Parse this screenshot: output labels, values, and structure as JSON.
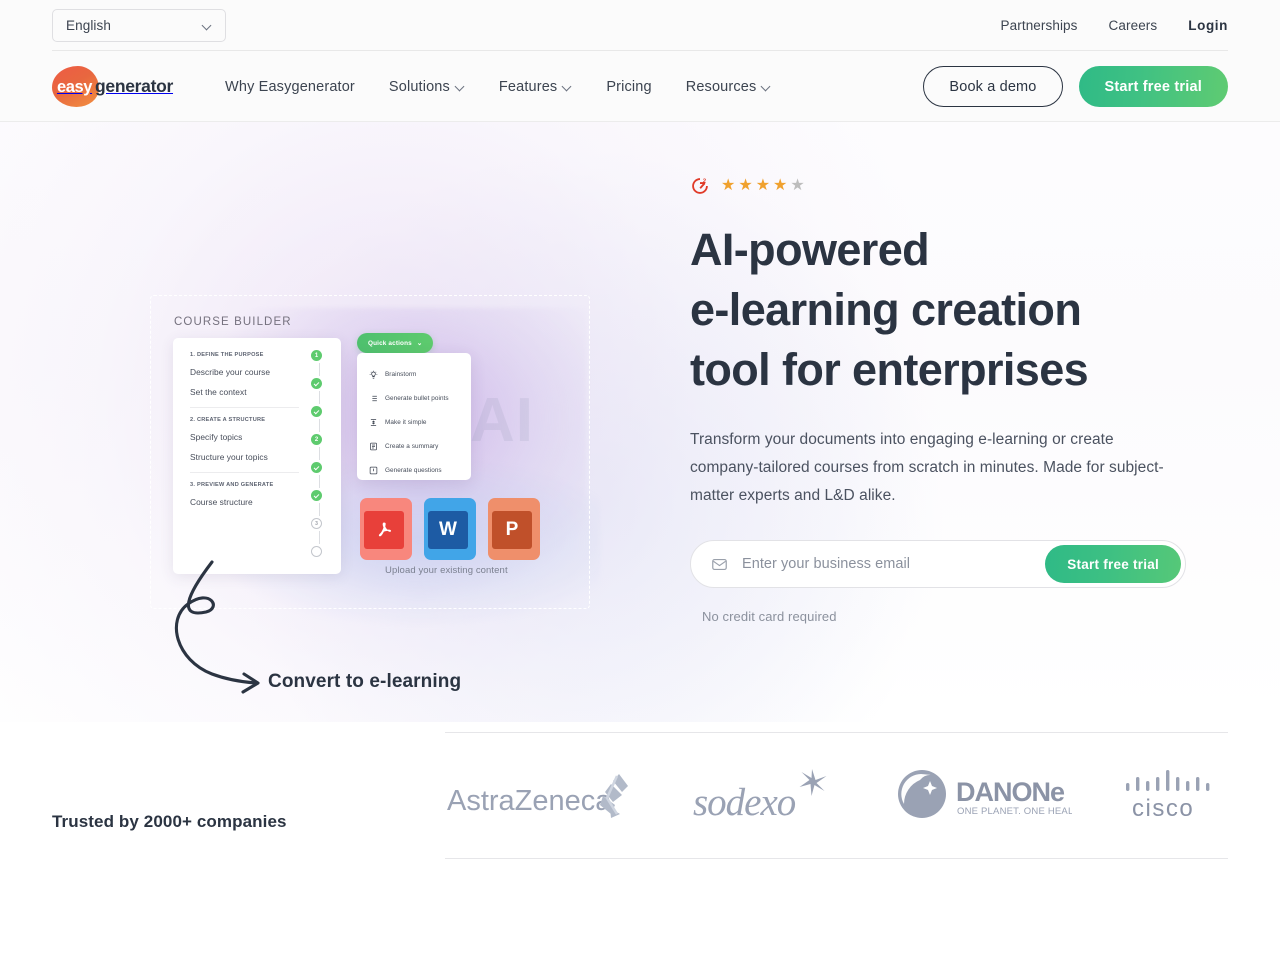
{
  "topbar": {
    "language": "English",
    "language_icon": "chevron-down-icon",
    "links": [
      {
        "label": "Partnerships",
        "bold": false
      },
      {
        "label": "Careers",
        "bold": false
      },
      {
        "label": "Login",
        "bold": true
      }
    ]
  },
  "nav": {
    "logo": {
      "mark_text": "easy",
      "word": "generator"
    },
    "items": [
      {
        "label": "Why Easygenerator",
        "has_dropdown": false
      },
      {
        "label": "Solutions",
        "has_dropdown": true
      },
      {
        "label": "Features",
        "has_dropdown": true
      },
      {
        "label": "Pricing",
        "has_dropdown": false
      },
      {
        "label": "Resources",
        "has_dropdown": true
      }
    ],
    "demo_button": "Book a demo",
    "trial_button": "Start free trial"
  },
  "hero": {
    "rating": {
      "badge": "G2",
      "badge_sup": "2",
      "stars": 4.5,
      "star_count": 5,
      "filled": 4
    },
    "headline_lines": [
      "AI-powered",
      "e-learning creation",
      "tool for enterprises"
    ],
    "headline": "AI-powered e-learning creation tool for enterprises",
    "lede": "Transform your documents into engaging e-learning or create company-tailored courses from scratch in minutes. Made for subject-matter experts and L&D alike.",
    "email_placeholder": "Enter your business email",
    "email_value": "",
    "email_icon": "mail-icon",
    "form_button": "Start free trial",
    "disclaimer": "No credit card required"
  },
  "illustration": {
    "watermark": "AI",
    "builder_label": "COURSE BUILDER",
    "builder_sections": [
      {
        "heading": "1. DEFINE THE PURPOSE",
        "items": [
          "Describe your course",
          "Set the context"
        ]
      },
      {
        "heading": "2. CREATE A STRUCTURE",
        "items": [
          "Specify topics",
          "Structure your topics"
        ]
      },
      {
        "heading": "3. PREVIEW AND GENERATE",
        "items": [
          "Course structure"
        ]
      }
    ],
    "quick_actions_button": "Quick actions",
    "quick_actions": [
      {
        "label": "Brainstorm",
        "icon": "lightbulb-icon"
      },
      {
        "label": "Generate bullet points",
        "icon": "list-icon"
      },
      {
        "label": "Make it simple",
        "icon": "compress-icon"
      },
      {
        "label": "Create a summary",
        "icon": "document-icon"
      },
      {
        "label": "Generate questions",
        "icon": "question-box-icon"
      }
    ],
    "files": [
      {
        "name": "pdf-file-icon",
        "letter": "",
        "color": "#e8403a",
        "color_light": "#f4796f"
      },
      {
        "name": "word-file-icon",
        "letter": "W",
        "color": "#1d5ba4",
        "color_light": "#41a5e8"
      },
      {
        "name": "powerpoint-file-icon",
        "letter": "P",
        "color": "#c0502a",
        "color_light": "#ef8f6b"
      }
    ],
    "upload_caption": "Upload your existing content",
    "convert_label": "Convert to e-learning"
  },
  "trusted": {
    "title": "Trusted by 2000+ companies",
    "logos": [
      {
        "name": "astrazeneca-logo",
        "label": "AstraZeneca"
      },
      {
        "name": "sodexo-logo",
        "label": "sodexo"
      },
      {
        "name": "danone-logo",
        "label": "DANONE",
        "tagline": "ONE PLANET. ONE HEALTH"
      },
      {
        "name": "cisco-logo",
        "label": "cisco"
      }
    ]
  },
  "colors": {
    "accent_green": "#3dc083",
    "text_dark": "#2b3442",
    "logo_orange": "#ee5b45",
    "star_gold": "#f0a12e",
    "logo_grey": "#9aa2b4"
  }
}
